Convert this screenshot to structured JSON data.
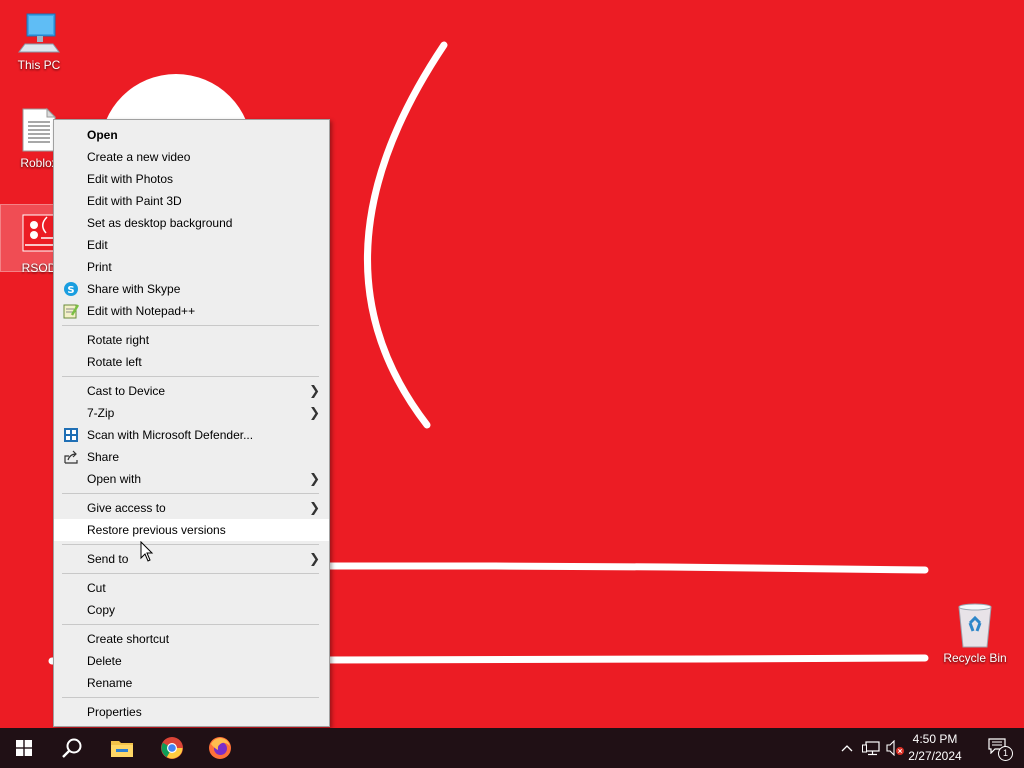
{
  "desktop": {
    "background_color": "#ec1c24",
    "icons": [
      {
        "label": "This PC",
        "icon": "computer-icon"
      },
      {
        "label": "Roblox",
        "icon": "text-file-icon"
      },
      {
        "label": "RSOD",
        "icon": "image-file-icon",
        "selected": true
      },
      {
        "label": "Recycle Bin",
        "icon": "recycle-bin-icon"
      }
    ]
  },
  "context_menu": {
    "items": [
      {
        "label": "Open",
        "bold": true
      },
      {
        "label": "Create a new video"
      },
      {
        "label": "Edit with Photos"
      },
      {
        "label": "Edit with Paint 3D"
      },
      {
        "label": "Set as desktop background"
      },
      {
        "label": "Edit"
      },
      {
        "label": "Print"
      },
      {
        "label": "Share with Skype",
        "icon": "skype-icon"
      },
      {
        "label": "Edit with Notepad++",
        "icon": "notepad-plus-plus-icon"
      },
      {
        "label": "Rotate right"
      },
      {
        "label": "Rotate left"
      },
      {
        "label": "Cast to Device",
        "submenu": true
      },
      {
        "label": "7-Zip",
        "submenu": true
      },
      {
        "label": "Scan with Microsoft Defender...",
        "icon": "defender-icon"
      },
      {
        "label": "Share",
        "icon": "share-icon"
      },
      {
        "label": "Open with",
        "submenu": true
      },
      {
        "label": "Give access to",
        "submenu": true
      },
      {
        "label": "Restore previous versions",
        "highlighted": true
      },
      {
        "label": "Send to",
        "submenu": true
      },
      {
        "label": "Cut"
      },
      {
        "label": "Copy"
      },
      {
        "label": "Create shortcut"
      },
      {
        "label": "Delete"
      },
      {
        "label": "Rename"
      },
      {
        "label": "Properties"
      }
    ]
  },
  "taskbar": {
    "pinned": [
      {
        "name": "start-button",
        "icon": "windows-logo-icon"
      },
      {
        "name": "search-button",
        "icon": "search-icon"
      },
      {
        "name": "file-explorer-button",
        "icon": "folder-icon"
      },
      {
        "name": "chrome-button",
        "icon": "chrome-icon"
      },
      {
        "name": "firefox-button",
        "icon": "firefox-icon"
      }
    ],
    "tray": {
      "overflow_icon": "chevron-up-icon",
      "network_icon": "network-icon",
      "volume_icon": "volume-muted-icon"
    },
    "clock": {
      "time": "4:50 PM",
      "date": "2/27/2024"
    },
    "notifications": {
      "icon": "action-center-icon",
      "count": "1"
    }
  }
}
